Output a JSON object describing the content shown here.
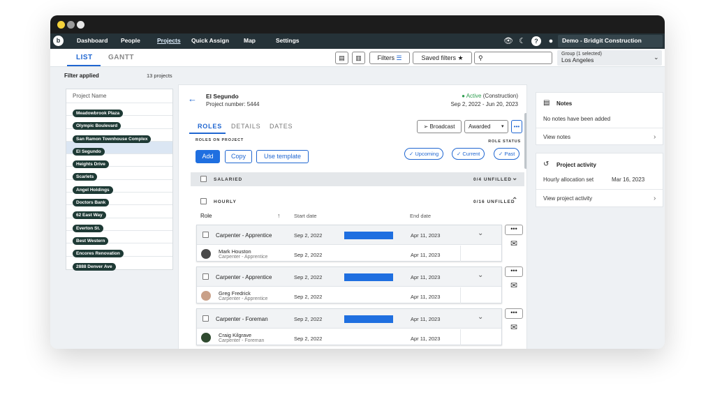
{
  "nav": {
    "items": [
      "Dashboard",
      "People",
      "Projects",
      "Quick Assign",
      "Map",
      "Settings"
    ],
    "active": "Projects",
    "org": "Demo - Bridgit Construction"
  },
  "toolbar": {
    "tabs": [
      "LIST",
      "GANTT"
    ],
    "filters_label": "Filters",
    "saved_filters_label": "Saved filters",
    "search_placeholder": "",
    "group_caption": "Group (1 selected)",
    "group_value": "Los Angeles"
  },
  "left": {
    "filter_applied": "Filter applied",
    "count": "13 projects",
    "column_header": "Project Name",
    "projects": [
      "Meadowbrook Plaza",
      "Olympic Boulevard",
      "San Ramon Townhouse Complex",
      "El Segundo",
      "Heights Drive",
      "Scarlets",
      "Angel Holdings",
      "Doctors Bank",
      "62 East Way",
      "Everton St.",
      "Best Western",
      "Encores Renovation",
      "2888 Denver Ave"
    ],
    "selected": "El Segundo"
  },
  "project": {
    "name": "El Segundo",
    "number": "Project number: 5444",
    "status_word": "Active",
    "status_type": "(Construction)",
    "dates": "Sep 2, 2022 - Jun 20, 2023",
    "tabs": [
      "ROLES",
      "DETAILS",
      "DATES"
    ],
    "active_tab": "ROLES",
    "broadcast_label": "Broadcast",
    "awarded_label": "Awarded",
    "roles_on_project": "ROLES ON PROJECT",
    "role_status": "ROLE STATUS",
    "add_label": "Add",
    "copy_label": "Copy",
    "template_label": "Use template",
    "chips": [
      "Upcoming",
      "Current",
      "Past"
    ],
    "salaried": {
      "label": "SALARIED",
      "count": "0/4 UNFILLED"
    },
    "hourly": {
      "label": "HOURLY",
      "count": "0/16 UNFILLED"
    },
    "columns": {
      "role": "Role",
      "start": "Start date",
      "end": "End date"
    },
    "roles": [
      {
        "title": "Carpenter - Apprentice",
        "start": "Sep 2, 2022",
        "end": "Apr 11, 2023",
        "person": "Mark Houston",
        "person_role": "Carpenter - Apprentice",
        "p_start": "Sep 2, 2022",
        "p_end": "Apr 11, 2023"
      },
      {
        "title": "Carpenter - Apprentice",
        "start": "Sep 2, 2022",
        "end": "Apr 11, 2023",
        "person": "Greg Fredrick",
        "person_role": "Carpenter - Apprentice",
        "p_start": "Sep 2, 2022",
        "p_end": "Apr 11, 2023"
      },
      {
        "title": "Carpenter - Foreman",
        "start": "Sep 2, 2022",
        "end": "Apr 11, 2023",
        "person": "Craig Kilgrave",
        "person_role": "Carpenter - Foreman",
        "p_start": "Sep 2, 2022",
        "p_end": "Apr 11, 2023"
      }
    ]
  },
  "notes": {
    "title": "Notes",
    "empty": "No notes have been added",
    "view": "View notes"
  },
  "activity": {
    "title": "Project activity",
    "item": "Hourly allocation set",
    "date": "Mar 16, 2023",
    "view": "View project activity"
  },
  "colors": {
    "accent": "#1f6fe0",
    "nav": "#253238",
    "pill": "#1e3a35",
    "active_status": "#2e9d4f"
  }
}
